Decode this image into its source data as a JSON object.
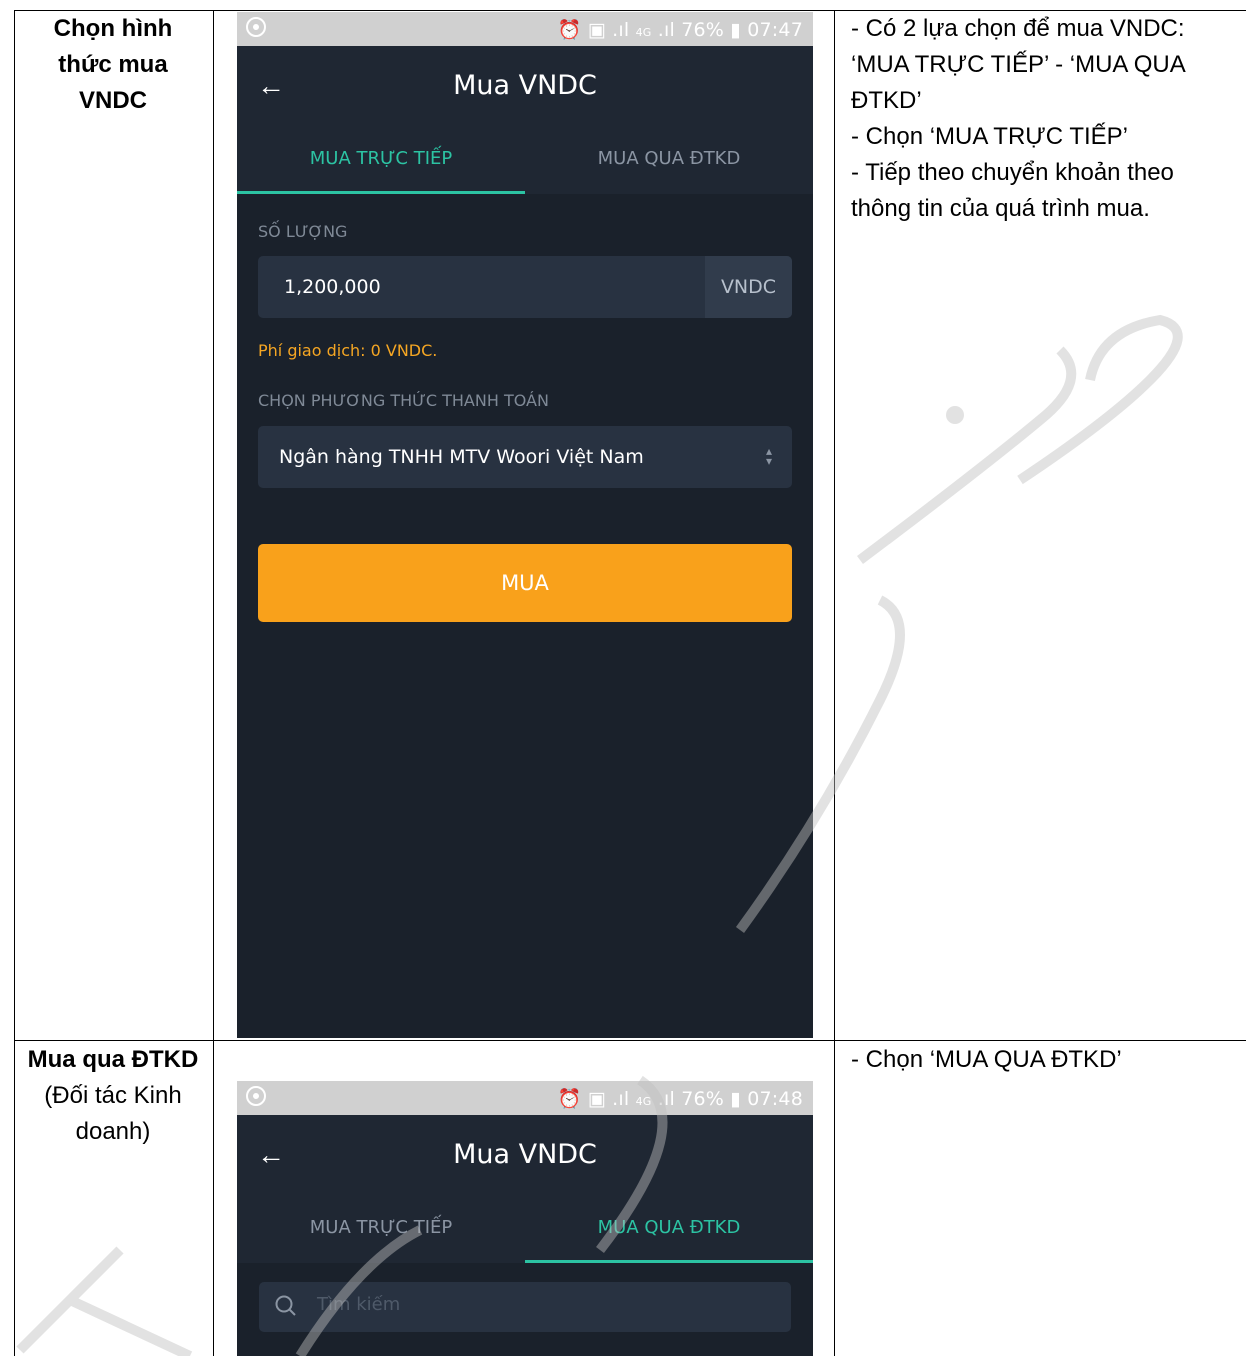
{
  "row1": {
    "left_text": "Chọn hình thức mua VNDC",
    "right_lines": [
      "- Có 2 lựa chọn để mua VNDC:",
      "‘MUA TRỰC TIẾP’ - ‘MUA QUA",
      "ĐTKD’",
      "- Chọn ‘MUA TRỰC TIẾP’",
      "- Tiếp theo chuyển khoản theo",
      "thông tin của quá trình mua."
    ],
    "phone": {
      "status_battery": "76%",
      "status_time": "07:47",
      "status_network": "4G",
      "title": "Mua VNDC",
      "tab_direct": "MUA TRỰC TIẾP",
      "tab_partner": "MUA QUA ĐTKD",
      "active_tab": "MUA TRỰC TIẾP",
      "quantity_label": "SỐ LƯỢNG",
      "quantity_value": "1,200,000",
      "quantity_unit": "VNDC",
      "fee_text": "Phí giao dịch: 0 VNDC.",
      "payment_label": "CHỌN PHƯƠNG THỨC THANH TOÁN",
      "payment_value": "Ngân hàng TNHH MTV Woori Việt Nam",
      "buy_button": "MUA"
    }
  },
  "row2": {
    "left_bold": "Mua qua ĐTKD",
    "left_rest": "(Đối tác Kinh doanh)",
    "right_text": "- Chọn ‘MUA QUA ĐTKD’",
    "phone": {
      "status_battery": "76%",
      "status_time": "07:48",
      "status_network": "4G",
      "title": "Mua VNDC",
      "tab_direct": "MUA TRỰC TIẾP",
      "tab_partner": "MUA QUA ĐTKD",
      "active_tab": "MUA QUA ĐTKD",
      "search_placeholder": "Tìm kiếm"
    }
  },
  "colors": {
    "accent": "#2cc3a3",
    "button": "#f9a11b",
    "background": "#1a212b"
  }
}
